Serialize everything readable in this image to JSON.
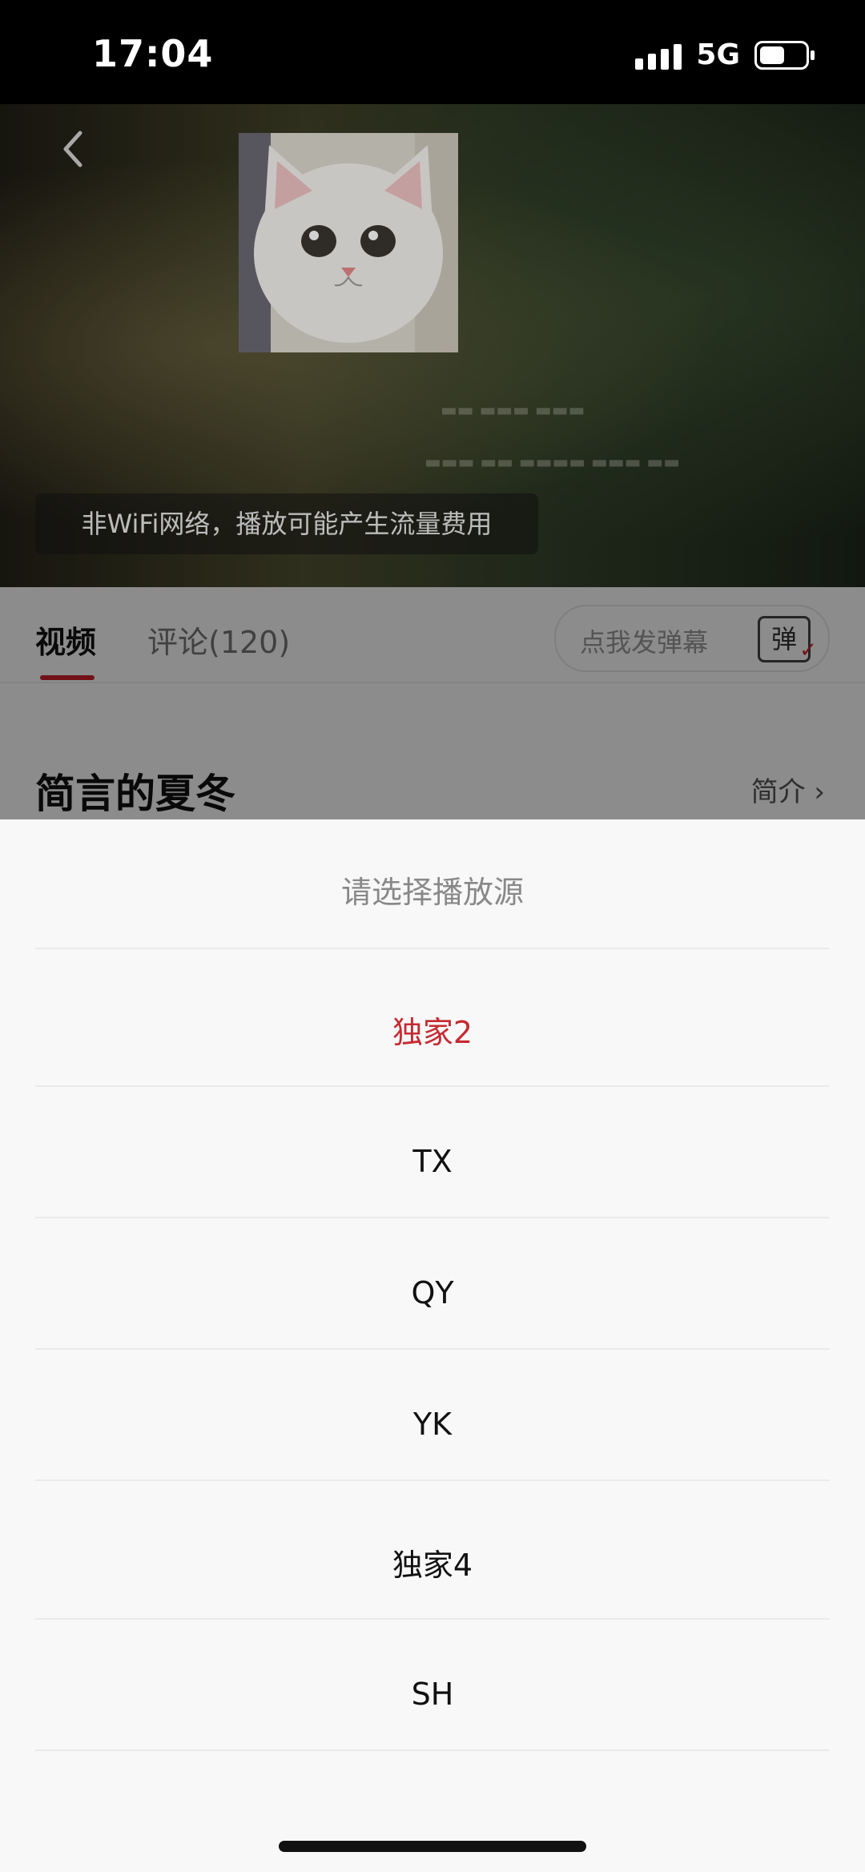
{
  "status_bar": {
    "time": "17:04",
    "network": "5G",
    "battery_level": 0.55
  },
  "video": {
    "toast": "非WiFi网络，播放可能产生流量费用"
  },
  "tabs": {
    "video": "视频",
    "comments": "评论(120)"
  },
  "danmaku": {
    "placeholder": "点我发弹幕",
    "icon_label": "弹"
  },
  "show": {
    "title": "简言的夏冬",
    "intro": "简介"
  },
  "sheet": {
    "title": "请选择播放源",
    "options": [
      {
        "label": "独家2",
        "selected": true
      },
      {
        "label": "TX",
        "selected": false
      },
      {
        "label": "QY",
        "selected": false
      },
      {
        "label": "YK",
        "selected": false
      },
      {
        "label": "独家4",
        "selected": false
      },
      {
        "label": "SH",
        "selected": false
      }
    ]
  },
  "colors": {
    "accent": "#c62a31"
  }
}
